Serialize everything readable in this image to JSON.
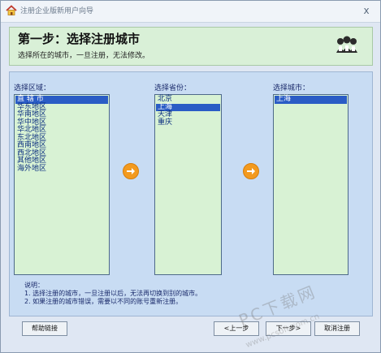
{
  "window": {
    "title": "注册企业版新用户向导",
    "close_glyph": "x"
  },
  "header": {
    "title": "第一步：选择注册城市",
    "subtitle": "选择所在的城市，一旦注册，无法修改。"
  },
  "labels": {
    "region": "选择区域：",
    "province": "选择省份：",
    "city": "选择城市："
  },
  "regions": {
    "items": [
      "直 辖 市",
      "华东地区",
      "华南地区",
      "华中地区",
      "华北地区",
      "东北地区",
      "西南地区",
      "西北地区",
      "其他地区",
      "海外地区"
    ],
    "selected_index": 0
  },
  "provinces": {
    "items": [
      "北京",
      "上海",
      "天津",
      "重庆"
    ],
    "selected_index": 1
  },
  "cities": {
    "items": [
      "上海"
    ],
    "selected_index": 0
  },
  "notes": {
    "title": "说明：",
    "line1": "1. 选择注册的城市，一旦注册以后，无法再切换到别的城市。",
    "line2": "2. 如果注册的城市错误，需要以不同的账号重新注册。"
  },
  "buttons": {
    "help": "帮助链接",
    "prev": "<上一步",
    "next": "下一步>",
    "cancel": "取消注册"
  },
  "watermark": {
    "main": "PC下载网",
    "sub": "www.pcsoft.com.cn"
  },
  "colors": {
    "header_bg": "#d9f0d7",
    "panel_bg": "#c8dcf3",
    "list_bg": "#d8f2d4",
    "selection": "#2a5cc5",
    "arrow": "#f39a1e"
  }
}
